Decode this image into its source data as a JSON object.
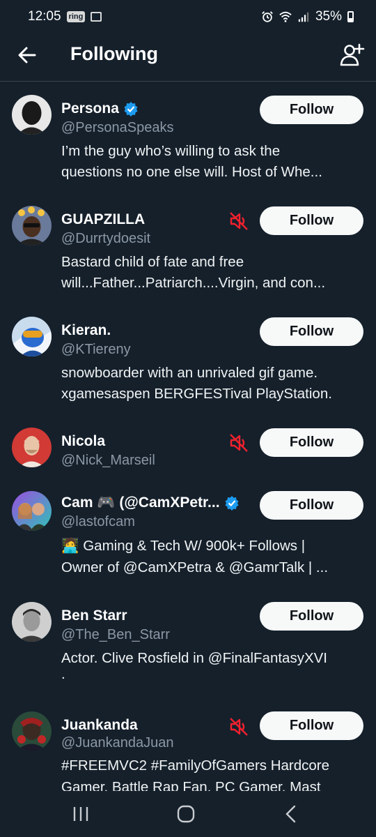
{
  "status_bar": {
    "time": "12:05",
    "ring_label": "ring",
    "battery": "35%"
  },
  "header": {
    "title": "Following"
  },
  "users": [
    {
      "name": "Persona",
      "handle": "@PersonaSpeaks",
      "verified": true,
      "muted": false,
      "bio_line1": "I’m the guy who’s willing to ask the",
      "bio_line2": "questions no one else will. Host of Whe...",
      "follow_label": "Follow"
    },
    {
      "name": "GUAPZILLA",
      "handle": "@Durrtydoesit",
      "verified": false,
      "muted": true,
      "bio_line1": "Bastard child of fate and free",
      "bio_line2": "will...Father...Patriarch....Virgin, and con...",
      "follow_label": "Follow"
    },
    {
      "name": "Kieran.",
      "handle": "@KTiereny",
      "verified": false,
      "muted": false,
      "bio_line1": "snowboarder with an unrivaled gif game.",
      "bio_line2": "xgamesaspen BERGFESTival PlayStation.",
      "follow_label": "Follow"
    },
    {
      "name": "Nicola",
      "handle": "@Nick_Marseil",
      "verified": false,
      "muted": true,
      "bio_line1": "",
      "bio_line2": "",
      "follow_label": "Follow"
    },
    {
      "name": "Cam 🎮 (@CamXPetr...",
      "handle": "@lastofcam",
      "verified": true,
      "muted": false,
      "bio_line1": "🧑‍💻 Gaming & Tech W/ 900k+ Follows |",
      "bio_line2": "Owner of @CamXPetra & @GamrTalk | ...",
      "follow_label": "Follow"
    },
    {
      "name": "Ben Starr",
      "handle": "@The_Ben_Starr",
      "verified": false,
      "muted": false,
      "bio_line1": "Actor. Clive Rosfield in @FinalFantasyXVI",
      "bio_line2": ".",
      "follow_label": "Follow"
    },
    {
      "name": "Juankanda",
      "handle": "@JuankandaJuan",
      "verified": false,
      "muted": true,
      "bio_line1": "#FREEMVC2 #FamilyOfGamers Hardcore",
      "bio_line2": "Gamer. Battle Rap Fan. PC Gamer. Mast",
      "follow_label": "Follow"
    }
  ],
  "colors": {
    "background": "#15202b",
    "handle": "#8b98a5",
    "verified": "#1d9bf0",
    "mute": "#f4212e",
    "button_bg": "#f7f9f9"
  }
}
